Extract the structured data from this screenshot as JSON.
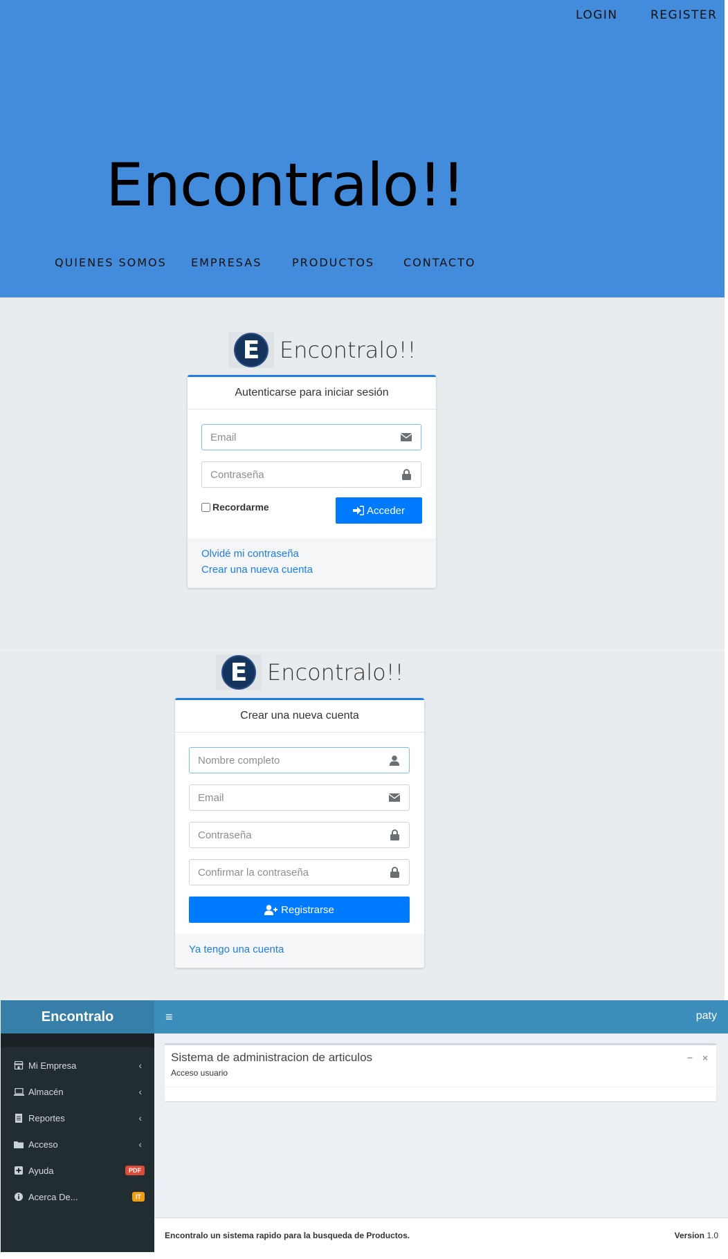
{
  "hero": {
    "nav": {
      "login": "LOGIN",
      "register": "REGISTER"
    },
    "title": "Encontralo!!",
    "menu": [
      "QUIENES SOMOS",
      "EMPRESAS",
      "PRODUCTOS",
      "CONTACTO"
    ]
  },
  "login": {
    "logo_letter": "E",
    "logo_text": "Encontralo!!",
    "header": "Autenticarse para iniciar sesión",
    "email_placeholder": "Email",
    "password_placeholder": "Contraseña",
    "remember_label": "Recordarme",
    "submit_label": "Acceder",
    "forgot_link": "Olvidé mi contraseña",
    "create_link": "Crear una nueva cuenta"
  },
  "register": {
    "logo_letter": "E",
    "logo_text": "Encontralo!!",
    "header": "Crear una nueva cuenta",
    "name_placeholder": "Nombre completo",
    "email_placeholder": "Email",
    "password_placeholder": "Contraseña",
    "confirm_placeholder": "Confirmar la contraseña",
    "submit_label": "Registrarse",
    "have_account_link": "Ya tengo una cuenta"
  },
  "admin": {
    "brand": "Encontralo",
    "user": "paty",
    "menu_icon": "≡",
    "sidebar": [
      {
        "label": "Mi Empresa",
        "icon": "store-icon",
        "chevron": "‹"
      },
      {
        "label": "Almacén",
        "icon": "laptop-icon",
        "chevron": "‹"
      },
      {
        "label": "Reportes",
        "icon": "file-icon",
        "chevron": "‹"
      },
      {
        "label": "Acceso",
        "icon": "folder-icon",
        "chevron": "‹"
      },
      {
        "label": "Ayuda",
        "icon": "plus-square-icon",
        "badge": "PDF",
        "badge_color": "#dd4b39"
      },
      {
        "label": "Acerca De...",
        "icon": "info-icon",
        "badge": "IT",
        "badge_color": "#f39c12"
      }
    ],
    "box": {
      "title": "Sistema de administracion de articulos",
      "subtitle": "Acceso usuario",
      "minimize": "−",
      "close": "×"
    },
    "footer": {
      "text": "Encontralo un sistema rapido para la busqueda de Productos.",
      "version_label": "Version",
      "version": "1.0"
    }
  },
  "colors": {
    "hero_bg": "#438cdb",
    "primary": "#007bff",
    "sidebar_bg": "#222d32",
    "topbar_bg": "#3c8dbc",
    "brand_bg": "#367fa9"
  }
}
